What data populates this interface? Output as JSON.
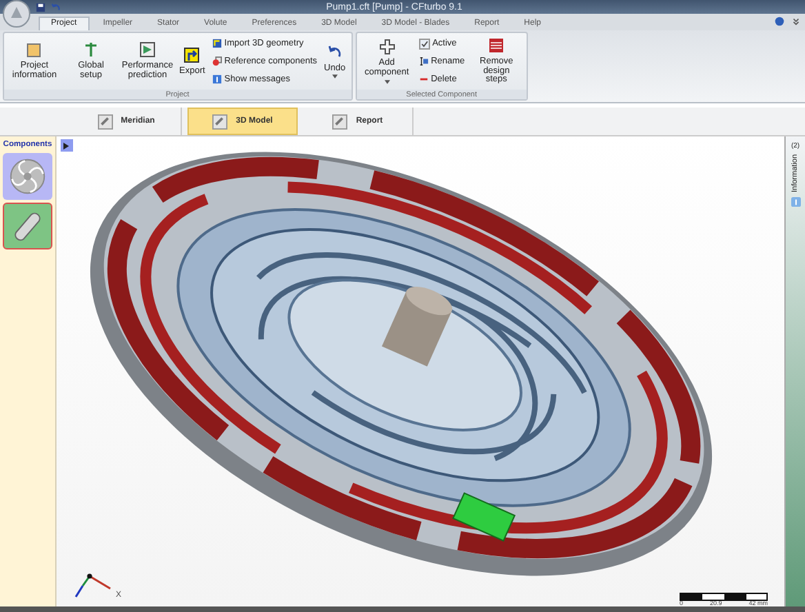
{
  "window": {
    "title": "Pump1.cft [Pump] - CFturbo 9.1"
  },
  "menu_tabs": [
    {
      "label": "Project",
      "selected": true
    },
    {
      "label": "Impeller",
      "selected": false
    },
    {
      "label": "Stator",
      "selected": false
    },
    {
      "label": "Volute",
      "selected": false
    },
    {
      "label": "Preferences",
      "selected": false
    },
    {
      "label": "3D Model",
      "selected": false
    },
    {
      "label": "3D Model - Blades",
      "selected": false
    },
    {
      "label": "Report",
      "selected": false
    },
    {
      "label": "Help",
      "selected": false
    }
  ],
  "ribbon_groups": [
    {
      "title": "Project",
      "columns": [
        [
          {
            "kind": "large",
            "label": "Project information"
          }
        ],
        [
          {
            "kind": "large",
            "label": "Global setup"
          }
        ],
        [
          {
            "kind": "large",
            "label": "Performance prediction"
          }
        ],
        [
          {
            "kind": "large",
            "label": "Export"
          }
        ],
        [
          {
            "kind": "small",
            "label": "Import 3D geometry"
          },
          {
            "kind": "small",
            "label": "Reference components"
          },
          {
            "kind": "small",
            "label": "Show messages"
          }
        ],
        [
          {
            "kind": "dropdown",
            "label": "Undo"
          }
        ]
      ]
    },
    {
      "title": "Selected Component",
      "columns": [
        [
          {
            "kind": "dropdown",
            "label": "Add component"
          }
        ],
        [
          {
            "kind": "check",
            "label": "Active",
            "checked": true
          },
          {
            "kind": "small",
            "label": "Rename"
          },
          {
            "kind": "small",
            "label": "Delete"
          }
        ],
        [
          {
            "kind": "large",
            "label": "Remove design steps"
          }
        ]
      ]
    }
  ],
  "view_tabs": [
    {
      "label": "Meridian",
      "selected": false
    },
    {
      "label": "3D Model",
      "selected": true
    },
    {
      "label": "Report",
      "selected": false
    }
  ],
  "sidebar": {
    "title": "Components",
    "items": [
      {
        "kind": "impeller",
        "selected": false
      },
      {
        "kind": "volute",
        "selected": true
      }
    ]
  },
  "viewport": {
    "axis_label": "X",
    "scale_labels": [
      "0",
      "20.9",
      "42 mm"
    ]
  },
  "right_panel": {
    "count": "(2)",
    "label": "Information"
  }
}
